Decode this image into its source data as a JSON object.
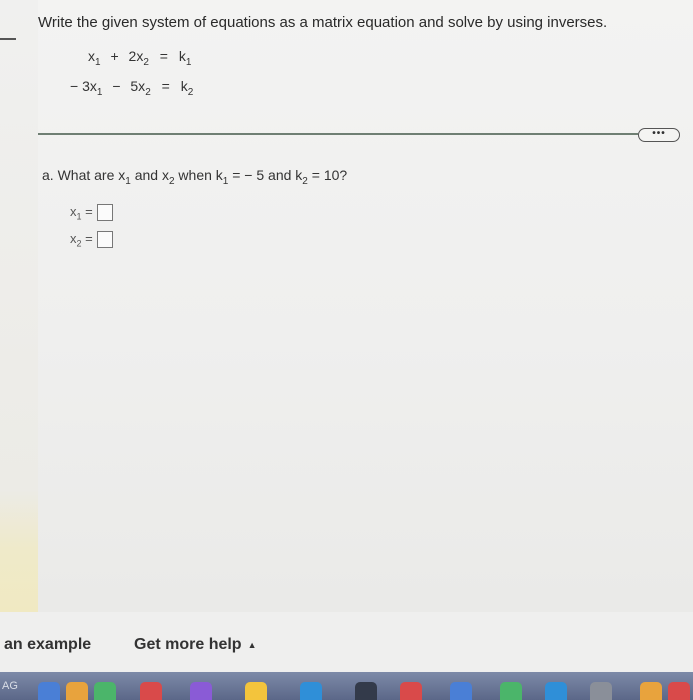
{
  "instructions": "Write the given system of equations as a matrix equation and solve by using inverses.",
  "equations": {
    "eq1": {
      "a": "x",
      "a_sub": "1",
      "op": "+",
      "b": "2x",
      "b_sub": "2",
      "eq": "=",
      "c": "k",
      "c_sub": "1"
    },
    "eq2": {
      "a": "− 3x",
      "a_sub": "1",
      "op": "−",
      "b": "5x",
      "b_sub": "2",
      "eq": "=",
      "c": "k",
      "c_sub": "2"
    }
  },
  "more_button": "•••",
  "question": {
    "prefix": "a. What are x",
    "s1": "1",
    "mid1": " and x",
    "s2": "2",
    "mid2": " when k",
    "s3": "1",
    "mid3": " = − 5 and k",
    "s4": "2",
    "suffix": " = 10?"
  },
  "answers": [
    {
      "var": "x",
      "sub": "1",
      "eq": "=",
      "value": ""
    },
    {
      "var": "x",
      "sub": "2",
      "eq": "=",
      "value": ""
    }
  ],
  "footer": {
    "example_label": "an example",
    "help_label": "Get more help",
    "help_caret": "▲"
  },
  "dock": {
    "partial_label": "AG",
    "accent_colors": [
      "#4a7fd6",
      "#e8a33d",
      "#4bb56a",
      "#d94a4a",
      "#8a5bd6",
      "#f3c43c",
      "#2f8fd8"
    ]
  }
}
